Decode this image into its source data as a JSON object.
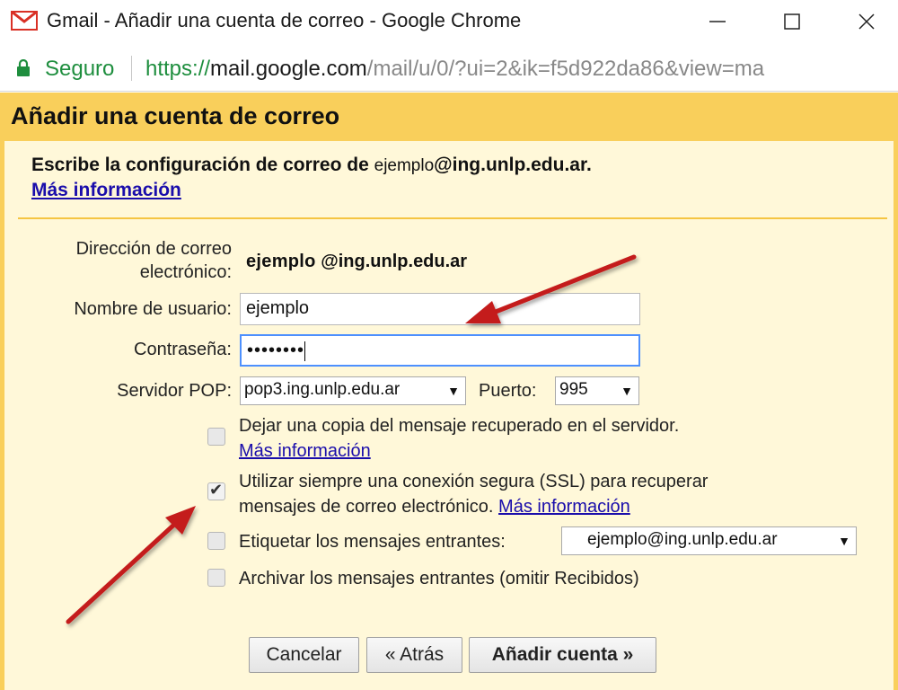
{
  "window": {
    "title": "Gmail - Añadir una cuenta de correo - Google Chrome",
    "minimize": "—",
    "maximize": "☐",
    "close": "✕"
  },
  "addressbar": {
    "secure_label": "Seguro",
    "url_scheme": "https://",
    "url_host": "mail.google.com",
    "url_path": "/mail/u/0/?ui=2&ik=f5d922da86&view=ma"
  },
  "dialog": {
    "title": "Añadir una cuenta de correo",
    "intro_prefix": "Escribe la configuración de correo de",
    "intro_local": "ejemplo",
    "intro_domain": "@ing.unlp.edu.ar.",
    "intro_link": "Más información"
  },
  "form": {
    "email_label": "Dirección de correo electrónico:",
    "email_local": "ejemplo",
    "email_domain": "@ing.unlp.edu.ar",
    "username_label": "Nombre de usuario:",
    "username_value": "ejemplo",
    "password_label": "Contraseña:",
    "password_value": "••••••••",
    "pop_label": "Servidor POP:",
    "pop_value": "pop3.ing.unlp.edu.ar",
    "port_label": "Puerto:",
    "port_value": "995"
  },
  "options": {
    "leave_copy": {
      "text": "Dejar una copia del mensaje recuperado en el servidor.",
      "link": "Más información",
      "checked": false
    },
    "ssl": {
      "text_line1": "Utilizar siempre una conexión segura (SSL) para recuperar",
      "text_line2": "mensajes de correo electrónico.",
      "link": "Más información",
      "checked": true
    },
    "label_incoming": {
      "text": "Etiquetar los mensajes entrantes:",
      "select_value": "ejemplo@ing.unlp.edu.ar",
      "checked": false
    },
    "archive": {
      "text": "Archivar los mensajes entrantes (omitir Recibidos)",
      "checked": false
    }
  },
  "buttons": {
    "cancel": "Cancelar",
    "back": "« Atrás",
    "add": "Añadir cuenta »"
  },
  "colors": {
    "header": "#f9cf5b",
    "body": "#fff8d9",
    "secure": "#1e8e3e",
    "link": "#1a0dab",
    "annotation_arrow": "#c41a1a"
  }
}
